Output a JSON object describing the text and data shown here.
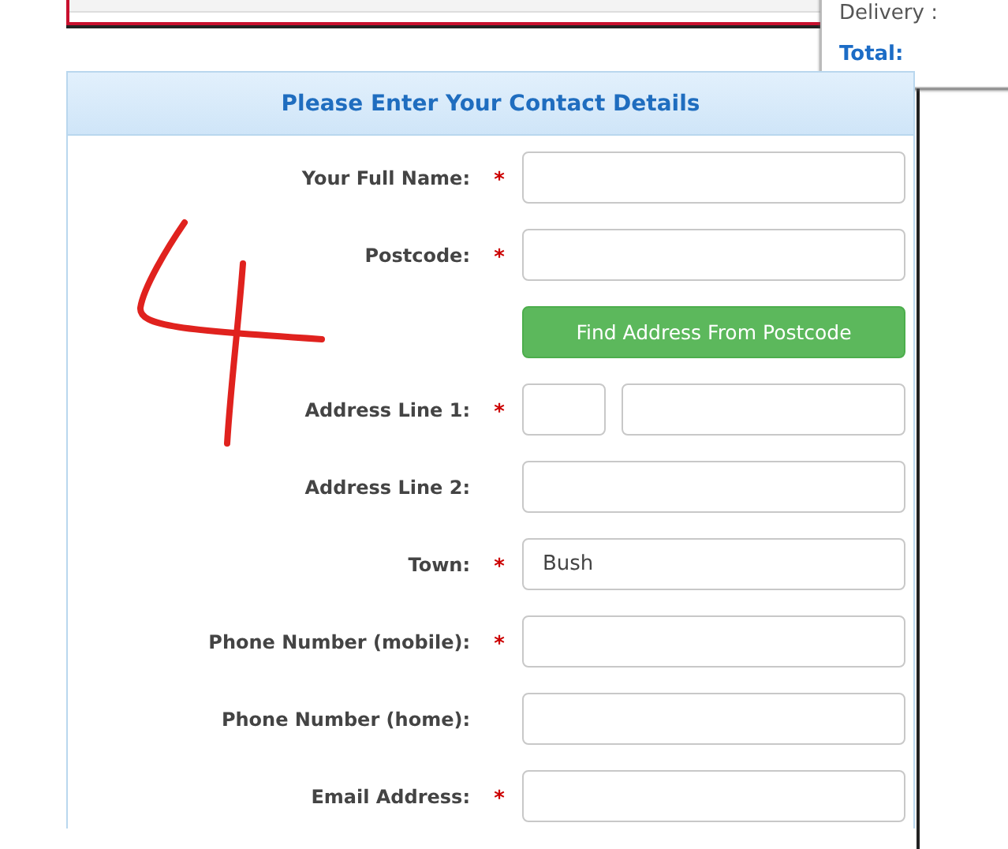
{
  "summary": {
    "rows": [
      {
        "label": "Delivery :",
        "kind": "plain"
      },
      {
        "label": "Total:",
        "kind": "total"
      }
    ]
  },
  "panel": {
    "title": "Please Enter Your Contact Details",
    "rows": [
      {
        "kind": "field",
        "label": "Your Full Name:",
        "mark": "*"
      },
      {
        "kind": "field",
        "label": "Postcode:",
        "mark": "*"
      },
      {
        "kind": "button",
        "label": "Find Address From Postcode"
      },
      {
        "kind": "split",
        "label": "Address Line 1:",
        "mark": "*"
      },
      {
        "kind": "field",
        "label": "Address Line 2:"
      },
      {
        "kind": "field",
        "label": "Town:",
        "mark": "*",
        "value": "Bush"
      },
      {
        "kind": "field",
        "label": "Phone Number (mobile):",
        "mark": "*"
      },
      {
        "kind": "field",
        "label": "Phone Number (home):"
      },
      {
        "kind": "field",
        "label": "Email Address:",
        "mark": "*"
      }
    ]
  }
}
